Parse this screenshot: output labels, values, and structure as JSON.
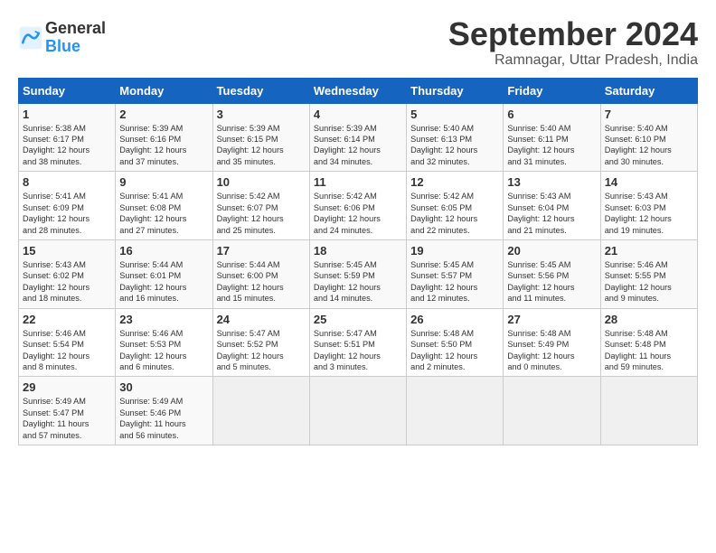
{
  "app": {
    "name_line1": "General",
    "name_line2": "Blue"
  },
  "header": {
    "month_year": "September 2024",
    "location": "Ramnagar, Uttar Pradesh, India"
  },
  "weekdays": [
    "Sunday",
    "Monday",
    "Tuesday",
    "Wednesday",
    "Thursday",
    "Friday",
    "Saturday"
  ],
  "weeks": [
    [
      {
        "day": "1",
        "sunrise": "5:38 AM",
        "sunset": "6:17 PM",
        "daylight": "12 hours and 38 minutes."
      },
      {
        "day": "2",
        "sunrise": "5:39 AM",
        "sunset": "6:16 PM",
        "daylight": "12 hours and 37 minutes."
      },
      {
        "day": "3",
        "sunrise": "5:39 AM",
        "sunset": "6:15 PM",
        "daylight": "12 hours and 35 minutes."
      },
      {
        "day": "4",
        "sunrise": "5:39 AM",
        "sunset": "6:14 PM",
        "daylight": "12 hours and 34 minutes."
      },
      {
        "day": "5",
        "sunrise": "5:40 AM",
        "sunset": "6:13 PM",
        "daylight": "12 hours and 32 minutes."
      },
      {
        "day": "6",
        "sunrise": "5:40 AM",
        "sunset": "6:11 PM",
        "daylight": "12 hours and 31 minutes."
      },
      {
        "day": "7",
        "sunrise": "5:40 AM",
        "sunset": "6:10 PM",
        "daylight": "12 hours and 30 minutes."
      }
    ],
    [
      {
        "day": "8",
        "sunrise": "5:41 AM",
        "sunset": "6:09 PM",
        "daylight": "12 hours and 28 minutes."
      },
      {
        "day": "9",
        "sunrise": "5:41 AM",
        "sunset": "6:08 PM",
        "daylight": "12 hours and 27 minutes."
      },
      {
        "day": "10",
        "sunrise": "5:42 AM",
        "sunset": "6:07 PM",
        "daylight": "12 hours and 25 minutes."
      },
      {
        "day": "11",
        "sunrise": "5:42 AM",
        "sunset": "6:06 PM",
        "daylight": "12 hours and 24 minutes."
      },
      {
        "day": "12",
        "sunrise": "5:42 AM",
        "sunset": "6:05 PM",
        "daylight": "12 hours and 22 minutes."
      },
      {
        "day": "13",
        "sunrise": "5:43 AM",
        "sunset": "6:04 PM",
        "daylight": "12 hours and 21 minutes."
      },
      {
        "day": "14",
        "sunrise": "5:43 AM",
        "sunset": "6:03 PM",
        "daylight": "12 hours and 19 minutes."
      }
    ],
    [
      {
        "day": "15",
        "sunrise": "5:43 AM",
        "sunset": "6:02 PM",
        "daylight": "12 hours and 18 minutes."
      },
      {
        "day": "16",
        "sunrise": "5:44 AM",
        "sunset": "6:01 PM",
        "daylight": "12 hours and 16 minutes."
      },
      {
        "day": "17",
        "sunrise": "5:44 AM",
        "sunset": "6:00 PM",
        "daylight": "12 hours and 15 minutes."
      },
      {
        "day": "18",
        "sunrise": "5:45 AM",
        "sunset": "5:59 PM",
        "daylight": "12 hours and 14 minutes."
      },
      {
        "day": "19",
        "sunrise": "5:45 AM",
        "sunset": "5:57 PM",
        "daylight": "12 hours and 12 minutes."
      },
      {
        "day": "20",
        "sunrise": "5:45 AM",
        "sunset": "5:56 PM",
        "daylight": "12 hours and 11 minutes."
      },
      {
        "day": "21",
        "sunrise": "5:46 AM",
        "sunset": "5:55 PM",
        "daylight": "12 hours and 9 minutes."
      }
    ],
    [
      {
        "day": "22",
        "sunrise": "5:46 AM",
        "sunset": "5:54 PM",
        "daylight": "12 hours and 8 minutes."
      },
      {
        "day": "23",
        "sunrise": "5:46 AM",
        "sunset": "5:53 PM",
        "daylight": "12 hours and 6 minutes."
      },
      {
        "day": "24",
        "sunrise": "5:47 AM",
        "sunset": "5:52 PM",
        "daylight": "12 hours and 5 minutes."
      },
      {
        "day": "25",
        "sunrise": "5:47 AM",
        "sunset": "5:51 PM",
        "daylight": "12 hours and 3 minutes."
      },
      {
        "day": "26",
        "sunrise": "5:48 AM",
        "sunset": "5:50 PM",
        "daylight": "12 hours and 2 minutes."
      },
      {
        "day": "27",
        "sunrise": "5:48 AM",
        "sunset": "5:49 PM",
        "daylight": "12 hours and 0 minutes."
      },
      {
        "day": "28",
        "sunrise": "5:48 AM",
        "sunset": "5:48 PM",
        "daylight": "11 hours and 59 minutes."
      }
    ],
    [
      {
        "day": "29",
        "sunrise": "5:49 AM",
        "sunset": "5:47 PM",
        "daylight": "11 hours and 57 minutes."
      },
      {
        "day": "30",
        "sunrise": "5:49 AM",
        "sunset": "5:46 PM",
        "daylight": "11 hours and 56 minutes."
      },
      null,
      null,
      null,
      null,
      null
    ]
  ]
}
